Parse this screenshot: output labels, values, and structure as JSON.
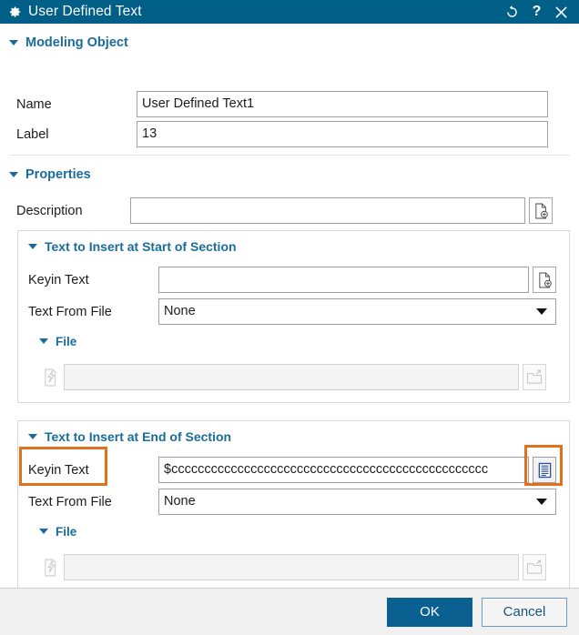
{
  "window": {
    "title": "User Defined Text",
    "icon": "gear-icon",
    "controls": {
      "reset": "reset-icon",
      "help": "?",
      "close": "close-icon"
    },
    "accent_color": "#005f87",
    "highlight_color": "#e2711d"
  },
  "sections": {
    "modeling_object": {
      "title": "Modeling Object",
      "name_label": "Name",
      "name_value": "User Defined Text1",
      "label_label": "Label",
      "label_value": "13"
    },
    "properties": {
      "title": "Properties",
      "description_label": "Description",
      "description_value": "",
      "description_placeholder": ""
    },
    "start_of_section": {
      "title": "Text to Insert at Start of Section",
      "keyin_label": "Keyin Text",
      "keyin_value": "",
      "textfromfile_label": "Text From File",
      "textfromfile_value": "None",
      "textfromfile_options": [
        "None"
      ],
      "file_title": "File",
      "file_value": "",
      "file_enabled": false
    },
    "end_of_section": {
      "title": "Text to Insert at End of Section",
      "keyin_label": "Keyin Text",
      "keyin_value": "$cccccccccccccccccccccccccccccccccccccccccccccccc",
      "textfromfile_label": "Text From File",
      "textfromfile_value": "None",
      "textfromfile_options": [
        "None"
      ],
      "file_title": "File",
      "file_value": "",
      "file_enabled": false
    }
  },
  "footer": {
    "ok_label": "OK",
    "cancel_label": "Cancel"
  }
}
